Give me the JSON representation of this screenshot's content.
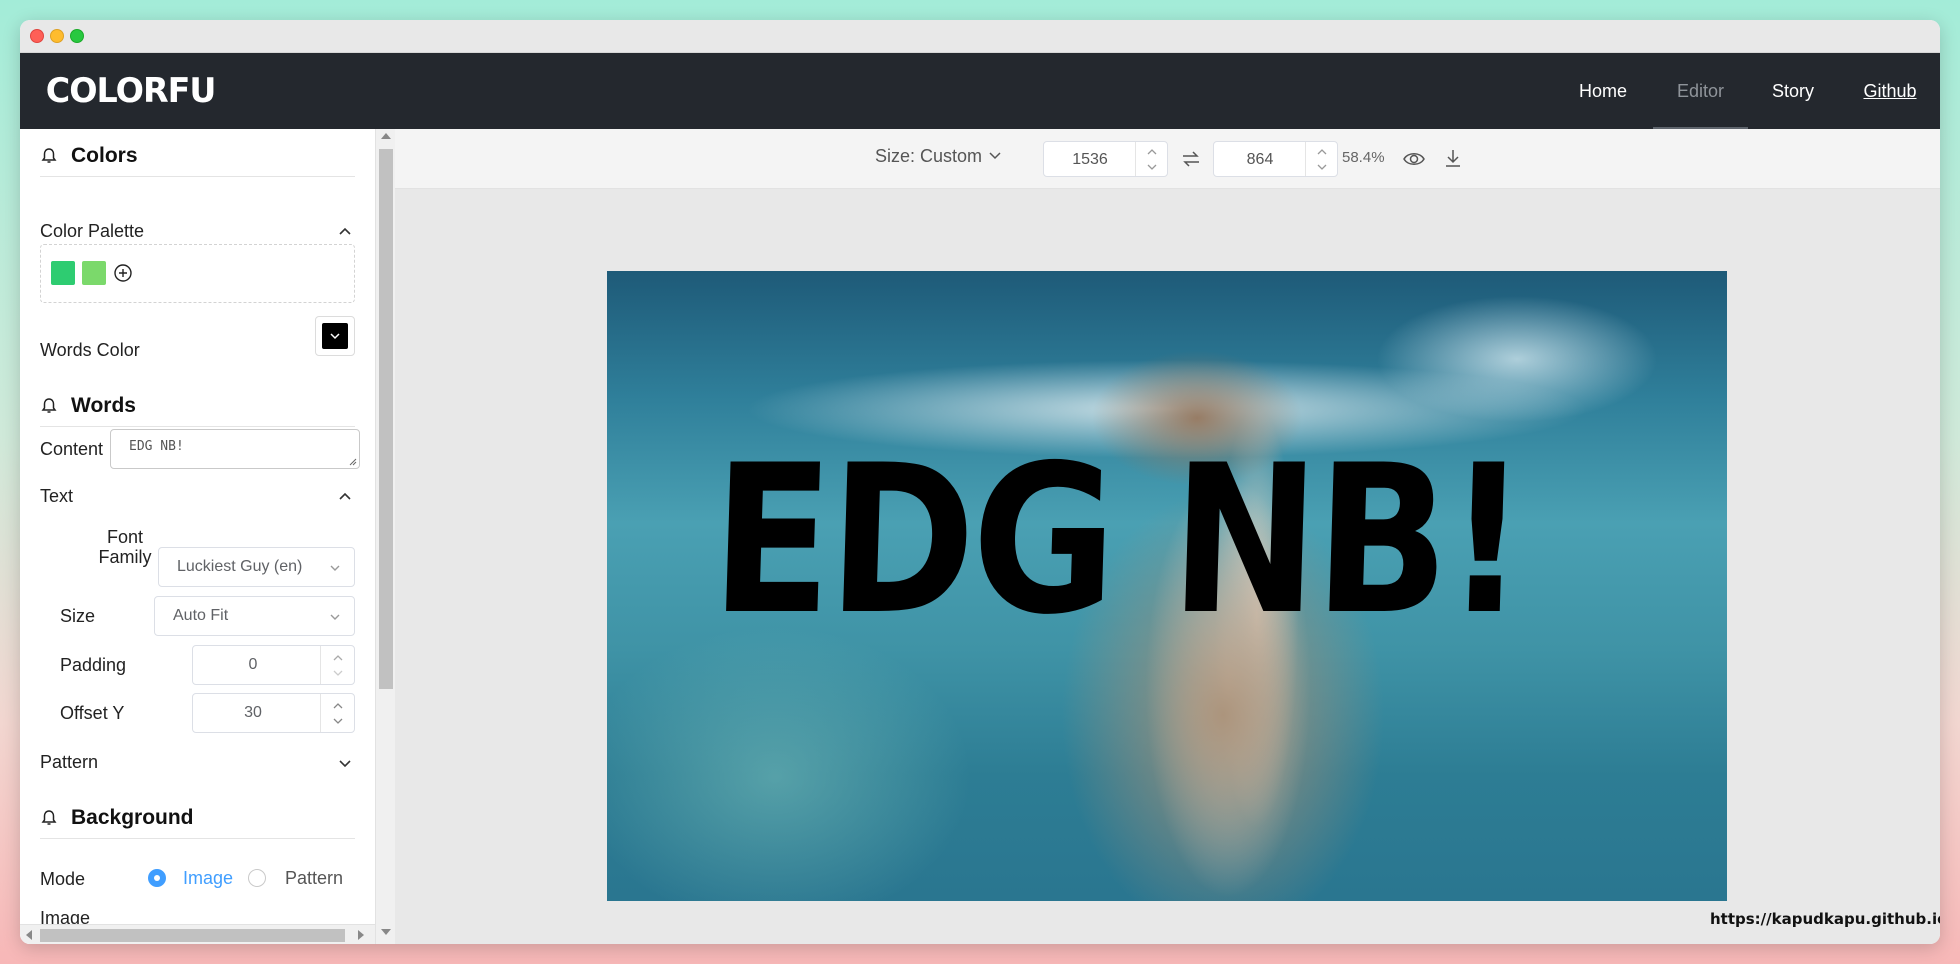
{
  "app": {
    "logo": "COLORFU"
  },
  "nav": {
    "items": [
      {
        "label": "Home"
      },
      {
        "label": "Editor"
      },
      {
        "label": "Story"
      },
      {
        "label": "Github"
      }
    ],
    "active": "Editor"
  },
  "sidebar": {
    "colors": {
      "title": "Colors",
      "palette_label": "Color Palette",
      "swatches": [
        "#2ecc71",
        "#7bd96b"
      ],
      "words_color_label": "Words Color",
      "words_color": "#000000"
    },
    "words": {
      "title": "Words",
      "content_label": "Content",
      "content_value": "EDG NB!",
      "text_label": "Text",
      "font_family_label": "Font\nFamily",
      "font_family_value": "Luckiest Guy (en)",
      "size_label": "Size",
      "size_value": "Auto Fit",
      "padding_label": "Padding",
      "padding_value": "0",
      "offset_y_label": "Offset Y",
      "offset_y_value": "30",
      "pattern_label": "Pattern"
    },
    "background": {
      "title": "Background",
      "mode_label": "Mode",
      "mode_options": [
        "Image",
        "Pattern"
      ],
      "mode_selected": "Image",
      "image_label": "Image"
    }
  },
  "toolbar": {
    "size_label": "Size: Custom",
    "width": "1536",
    "height": "864",
    "zoom": "58.4%"
  },
  "canvas": {
    "words": "EDG NB!"
  },
  "footer": {
    "url": "https://kapudkapu.github.io"
  },
  "colors": {
    "accent": "#409eff",
    "navbar": "#24282e"
  }
}
